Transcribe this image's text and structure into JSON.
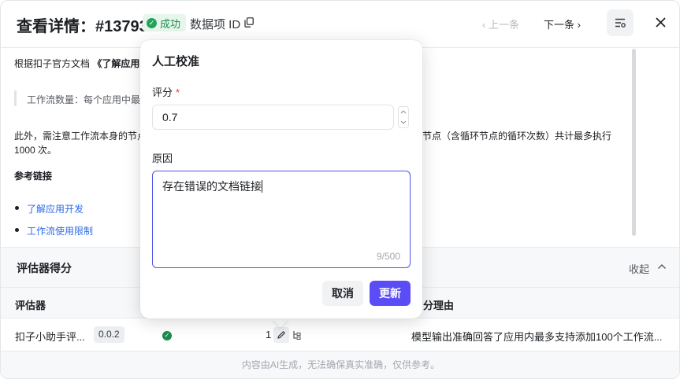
{
  "header": {
    "title": "查看详情：#13793",
    "status_badge": "成功",
    "item_id_label": "数据项 ID",
    "prev_label": "上一条",
    "next_label": "下一条"
  },
  "doc": {
    "line1_prefix": "根据扣子官方文档",
    "line1_quote": "《了解应用",
    "quote_text": "工作流数量：每个应用中最",
    "line3_a": "此外，需注意工作流本身的节点",
    "line3_b": "节点（含循环节点的循环次数）共计最多执行",
    "line4": "1000 次。",
    "ref_heading": "参考链接",
    "links": [
      "了解应用开发",
      "工作流使用限制"
    ]
  },
  "evaluator": {
    "section_title": "评估器得分",
    "collapse_label": "收起",
    "columns": [
      "评估器",
      "分理由"
    ],
    "row": {
      "name": "扣子小助手评...",
      "version": "0.0.2",
      "score": "1",
      "reason": "模型输出准确回答了应用内最多支持添加100个工作流..."
    },
    "footer_note": "内容由AI生成，无法确保真实准确，仅供参考。"
  },
  "calibration": {
    "title": "人工校准",
    "score_label": "评分",
    "required_mark": "*",
    "score_value": "0.7",
    "reason_label": "原因",
    "reason_value": "存在错误的文档链接",
    "char_count": "9/500",
    "cancel_label": "取消",
    "update_label": "更新"
  },
  "colors": {
    "accent": "#5b4df5",
    "success": "#1a8d4c",
    "link": "#2f6ae6"
  }
}
